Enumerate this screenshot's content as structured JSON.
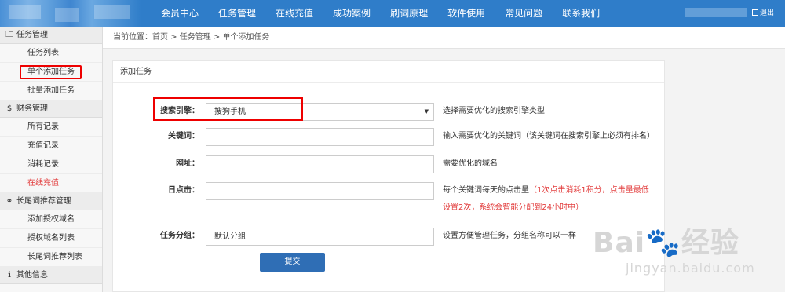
{
  "nav": {
    "items": [
      "会员中心",
      "任务管理",
      "在线充值",
      "成功案例",
      "刷词原理",
      "软件使用",
      "常见问题",
      "联系我们"
    ],
    "logout_icon": "logout-icon",
    "logout": "退出"
  },
  "sidebar": {
    "sections": [
      {
        "icon": "folder-icon",
        "glyph": "🗀",
        "title": "任务管理",
        "items": [
          "任务列表",
          "单个添加任务",
          "批量添加任务"
        ]
      },
      {
        "icon": "dollar-icon",
        "glyph": "$",
        "title": "财务管理",
        "items": [
          "所有记录",
          "充值记录",
          "消耗记录",
          "在线充值"
        ]
      },
      {
        "icon": "link-icon",
        "glyph": "⚭",
        "title": "长尾词推荐管理",
        "items": [
          "添加授权域名",
          "授权域名列表",
          "长尾词推荐列表"
        ]
      },
      {
        "icon": "info-icon",
        "glyph": "ℹ",
        "title": "其他信息",
        "items": []
      }
    ]
  },
  "breadcrumb": "当前位置：首页 > 任务管理 > 单个添加任务",
  "form": {
    "title": "添加任务",
    "engine_label": "搜索引擎：",
    "engine_value": "搜狗手机",
    "engine_help": "选择需要优化的搜索引擎类型",
    "keyword_label": "关键词：",
    "keyword_value": "",
    "keyword_help": "输入需要优化的关键词（该关键词在搜索引擎上必须有排名）",
    "url_label": "网址：",
    "url_value": "",
    "url_help": "需要优化的域名",
    "clicks_label": "日点击：",
    "clicks_value": "",
    "clicks_help": "每个关键词每天的点击量",
    "clicks_help_red": "（1次点击消耗1积分，点击量最低设置2次，系统会智能分配到24小时中）",
    "group_label": "任务分组：",
    "group_value": "默认分组",
    "group_help": "设置方便管理任务，分组名称可以一样",
    "submit": "提交"
  },
  "watermark": {
    "brand": "Bai🐾经验",
    "url": "jingyan.baidu.com"
  },
  "colors": {
    "topbar": "#2f7dc9",
    "submit": "#2f6eb5",
    "highlight": "#e23c3c"
  }
}
